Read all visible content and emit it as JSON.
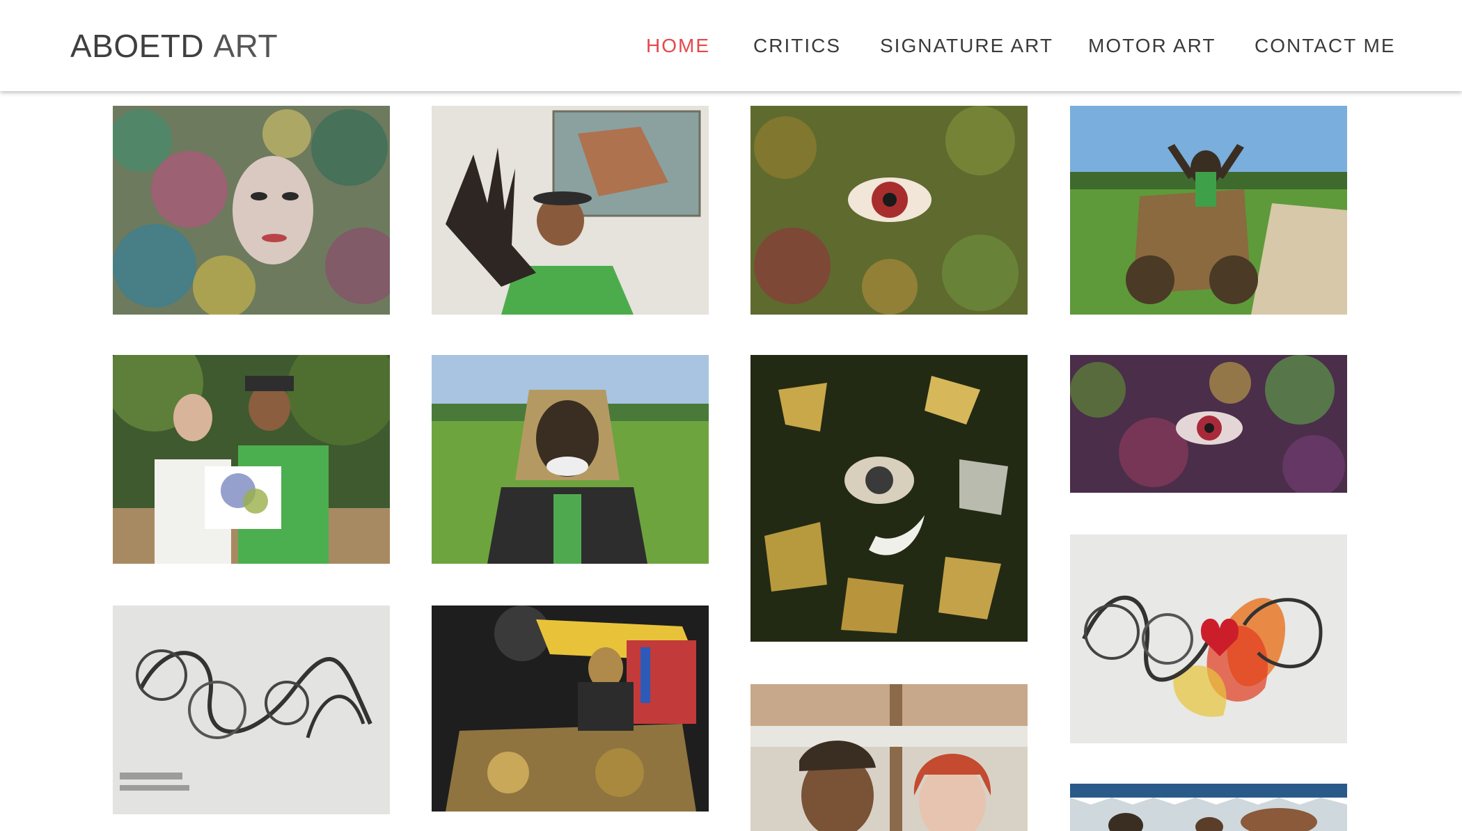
{
  "site": {
    "brand_part1": "ABOETD",
    "brand_part2": "ART"
  },
  "nav": {
    "items": [
      {
        "label": "HOME",
        "active": true
      },
      {
        "label": "CRITICS",
        "active": false
      },
      {
        "label": "SIGNATURE ART",
        "active": false
      },
      {
        "label": "MOTOR ART",
        "active": false
      },
      {
        "label": "CONTACT ME",
        "active": false
      }
    ]
  },
  "colors": {
    "accent": "#e4484a",
    "text": "#3a3a3a",
    "background": "#ffffff"
  },
  "gallery": {
    "images": [
      {
        "subject": "colorful swirl painting with woman's face"
      },
      {
        "subject": "artist in green shirt reaching toward camera beside painting"
      },
      {
        "subject": "green ornate painting with large red eye"
      },
      {
        "subject": "person with raised arms on decorated motorbike in rice field"
      },
      {
        "subject": "two people holding a drawing in a garden"
      },
      {
        "subject": "person in lion mask costume in rice field"
      },
      {
        "subject": "dark painting with golden shapes and central eye"
      },
      {
        "subject": "purple and green painting with red eye"
      },
      {
        "subject": "ink signature drawing on paper"
      },
      {
        "subject": "costumed rider on gold decorated motorbike at event"
      },
      {
        "subject": "two people smiling under pavilion"
      },
      {
        "subject": "signature drawing with red heart and orange flames"
      },
      {
        "subject": "crowd under blue and white canopy"
      }
    ]
  }
}
